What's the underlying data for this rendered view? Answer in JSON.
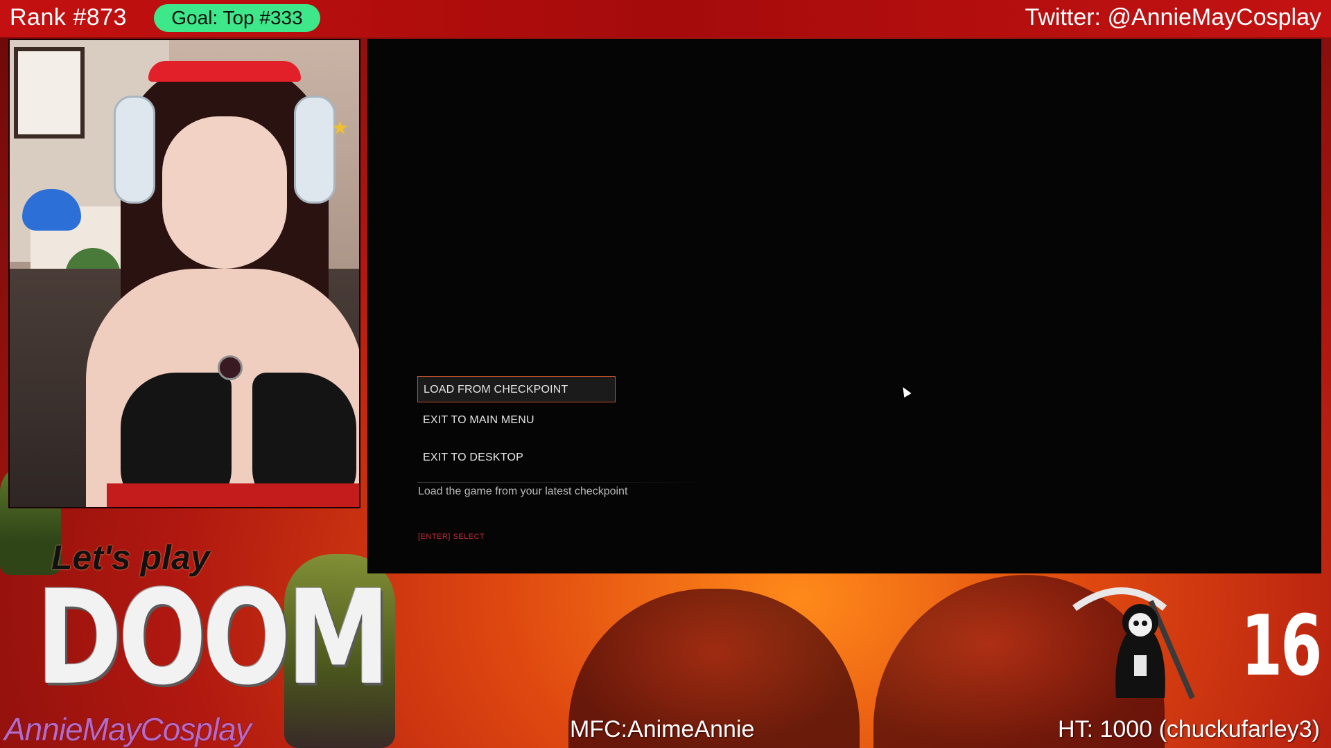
{
  "overlay": {
    "rank": "Rank #873",
    "goal": "Goal: Top #333",
    "twitter": "Twitter: @AnnieMayCosplay",
    "lets_play": "Let's play",
    "game_logo": "DOOM",
    "brand": "AnnieMayCosplay",
    "mfc": "MFC:AnimeAnnie",
    "high_tip": "HT: 1000 (chuckufarley3)",
    "counter": "16"
  },
  "game_menu": {
    "items": [
      {
        "label": "LOAD FROM CHECKPOINT",
        "selected": true
      },
      {
        "label": "EXIT TO MAIN MENU",
        "selected": false
      },
      {
        "label": "EXIT TO DESKTOP",
        "selected": false
      }
    ],
    "description": "Load the game from your latest checkpoint",
    "hint": "[ENTER] SELECT"
  },
  "colors": {
    "overlay_bar": "#b60e0e",
    "goal_pill": "#3ee88a",
    "menu_selection_border": "#c4512a",
    "hint_text": "#c22a3a",
    "brand_text": "#b86ac8"
  },
  "icons": {
    "cursor": "mouse-pointer-icon",
    "reaper": "grim-reaper-icon",
    "star": "star-icon"
  }
}
